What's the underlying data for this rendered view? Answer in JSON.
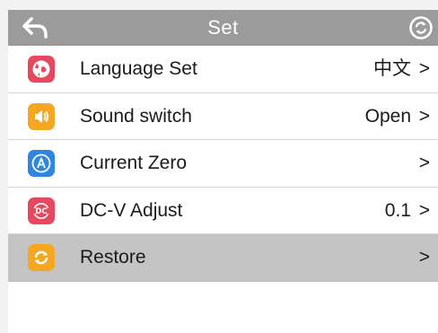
{
  "header": {
    "title": "Set",
    "back_icon": "back-arrow-icon",
    "refresh_icon": "refresh-icon"
  },
  "colors": {
    "header_bg": "#9b9b9b",
    "selected_row_bg": "#c4c4c4",
    "language_icon": "#e8485f",
    "sound_icon": "#f5a623",
    "zero_icon": "#2f86e0",
    "dcv_icon": "#e8485f",
    "restore_icon": "#f5a623"
  },
  "settings": {
    "items": [
      {
        "label": "Language Set",
        "value": "中文",
        "chevron": ">",
        "icon": "globe-icon"
      },
      {
        "label": "Sound switch",
        "value": "Open",
        "chevron": ">",
        "icon": "speaker-icon"
      },
      {
        "label": "Current Zero",
        "value": "",
        "chevron": ">",
        "icon": "circle-a-icon"
      },
      {
        "label": "DC-V Adjust",
        "value": "0.1",
        "chevron": ">",
        "icon": "dc-adjust-icon"
      },
      {
        "label": "Restore",
        "value": "",
        "chevron": ">",
        "icon": "restore-icon",
        "selected": true
      }
    ],
    "dc_icon_text": "DC"
  }
}
